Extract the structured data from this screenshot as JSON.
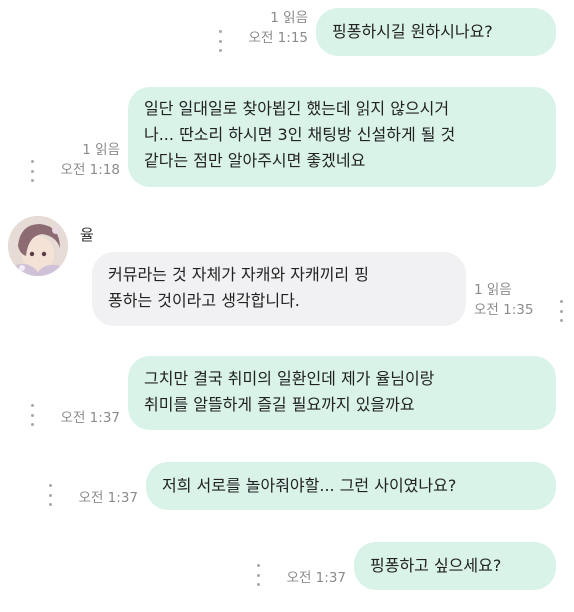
{
  "messages": [
    {
      "text": "핑퐁하시길 원하시나요?",
      "read": "1 읽음",
      "time": "오전 1:15"
    },
    {
      "text": "일단 일대일로 찾아뵙긴 했는데 읽지 않으시거\n나... 딴소리 하시면 3인 채팅방 신설하게 될 것\n같다는 점만 알아주시면 좋겠네요",
      "read": "1 읽음",
      "time": "오전 1:18"
    },
    {
      "text": "커뮤라는 것 자체가 자캐와 자캐끼리 핑\n퐁하는 것이라고 생각합니다.",
      "read": "1 읽음",
      "time": "오전 1:35",
      "sender": "율"
    },
    {
      "text": "그치만 결국 취미의 일환인데 제가 율님이랑\n취미를 알뜰하게 즐길 필요까지 있을까요",
      "time": "오전 1:37"
    },
    {
      "text": "저희 서로를 놀아줘야할... 그런 사이였나요?",
      "time": "오전 1:37"
    },
    {
      "text": "핑퐁하고 싶으세요?",
      "time": "오전 1:37"
    }
  ],
  "colors": {
    "own_bubble": "#d9f3e8",
    "other_bubble": "#f1f1f3",
    "meta_text": "#8b8b8b"
  },
  "icons": {
    "more": "vertical-ellipsis-icon",
    "avatar": "profile-avatar"
  }
}
